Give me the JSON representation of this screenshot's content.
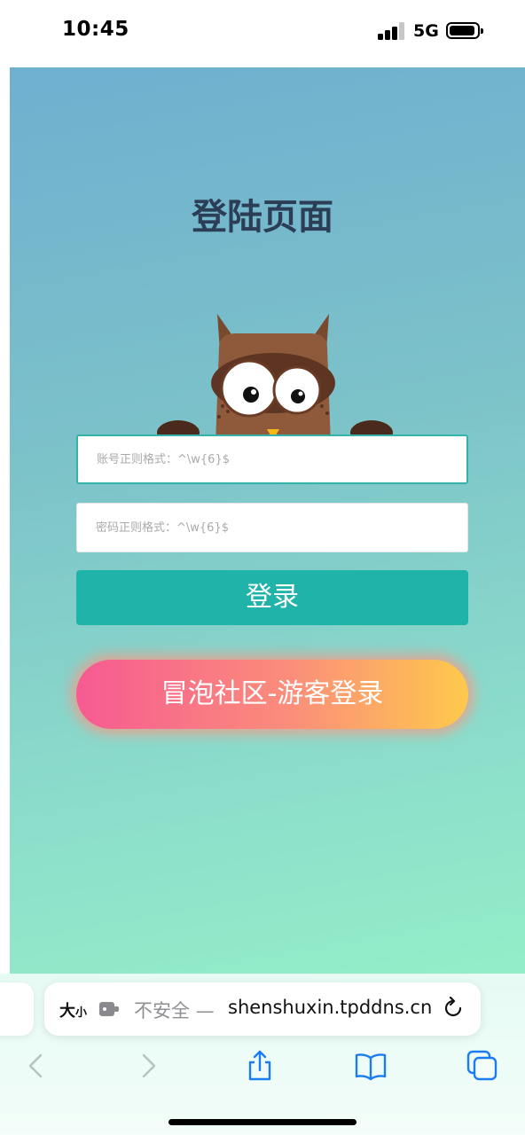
{
  "status_bar": {
    "time": "10:45",
    "network": "5G"
  },
  "page": {
    "title": "登陆页面",
    "account_placeholder": "账号正则格式：^\\w{6}$",
    "password_placeholder": "密码正则格式：^\\w{6}$",
    "login_label": "登录",
    "guest_label": "冒泡社区-游客登录"
  },
  "browser": {
    "text_size_label": "大",
    "text_size_small": "小",
    "insecure_label": "不安全 —",
    "url": "shenshuxin.tpddns.cn"
  },
  "colors": {
    "title": "#2c3e56",
    "login_button": "#20b3aa",
    "guest_gradient_start": "#f65a92",
    "guest_gradient_end": "#fec94c",
    "ios_blue": "#1a7cf5"
  },
  "icons": [
    "signal-icon",
    "battery-icon",
    "owl-mascot",
    "extension-icon",
    "reload-icon",
    "back-icon",
    "forward-icon",
    "share-icon",
    "bookmarks-icon",
    "tabs-icon"
  ]
}
